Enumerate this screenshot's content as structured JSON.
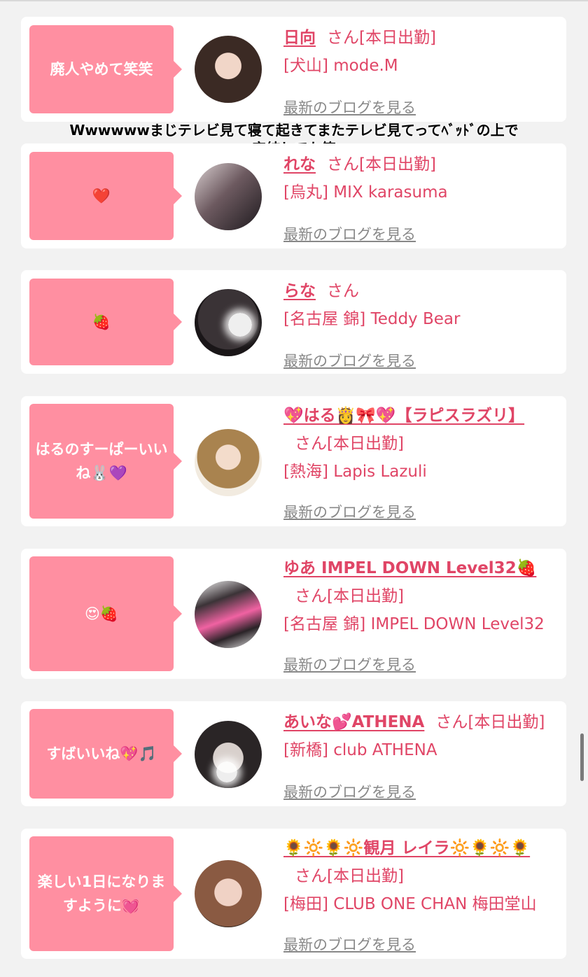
{
  "cards": [
    {
      "bubble": "廃人やめて笑笑",
      "name": "日向",
      "san": "さん[本日出勤]",
      "shop": "[犬山] mode.M",
      "blog": "最新のブログを見る"
    },
    {
      "bubble": "❤️",
      "name": "れな",
      "san": "さん[本日出勤]",
      "shop": "[烏丸] MIX karasuma",
      "blog": "最新のブログを見る"
    },
    {
      "bubble": "🍓",
      "name": "らな",
      "san": "さん",
      "shop": "[名古屋 錦] Teddy Bear",
      "blog": "最新のブログを見る"
    },
    {
      "bubble": "はるのすーぱーいいね🐰💜",
      "name": "💖はる👸🎀💖【ラピスラズリ】",
      "san": "さん[本日出勤]",
      "shop": "[熱海] Lapis Lazuli",
      "blog": "最新のブログを見る"
    },
    {
      "bubble": "😍🍓",
      "name": "ゆあ IMPEL DOWN Level32🍓",
      "san": "さん[本日出勤]",
      "shop": "[名古屋 錦] IMPEL DOWN Level32",
      "blog": "最新のブログを見る"
    },
    {
      "bubble": "すばいいね💖🎵",
      "name": "あいな💕ATHENA",
      "san": "さん[本日出勤]",
      "shop": "[新橋] club ATHENA",
      "blog": "最新のブログを見る"
    },
    {
      "bubble": "楽しい1日になりますように💓",
      "name": "🌻🔆🌻🔆観月 レイラ🔆🌻🔆🌻",
      "san": "さん[本日出勤]",
      "shop": "[梅田] CLUB ONE CHAN 梅田堂山",
      "blog": "最新のブログを見る"
    }
  ],
  "overlay_caption": {
    "line1": "Wwwwwwまじテレビ見て寝て起きてまたテレビ見てってﾍﾞｯﾄﾞの上で",
    "line2": "完結してた笑"
  },
  "colors": {
    "accent": "#e04566",
    "bubble": "#ff8fa1",
    "link_gray": "#888888",
    "background": "#f2f2f2"
  }
}
